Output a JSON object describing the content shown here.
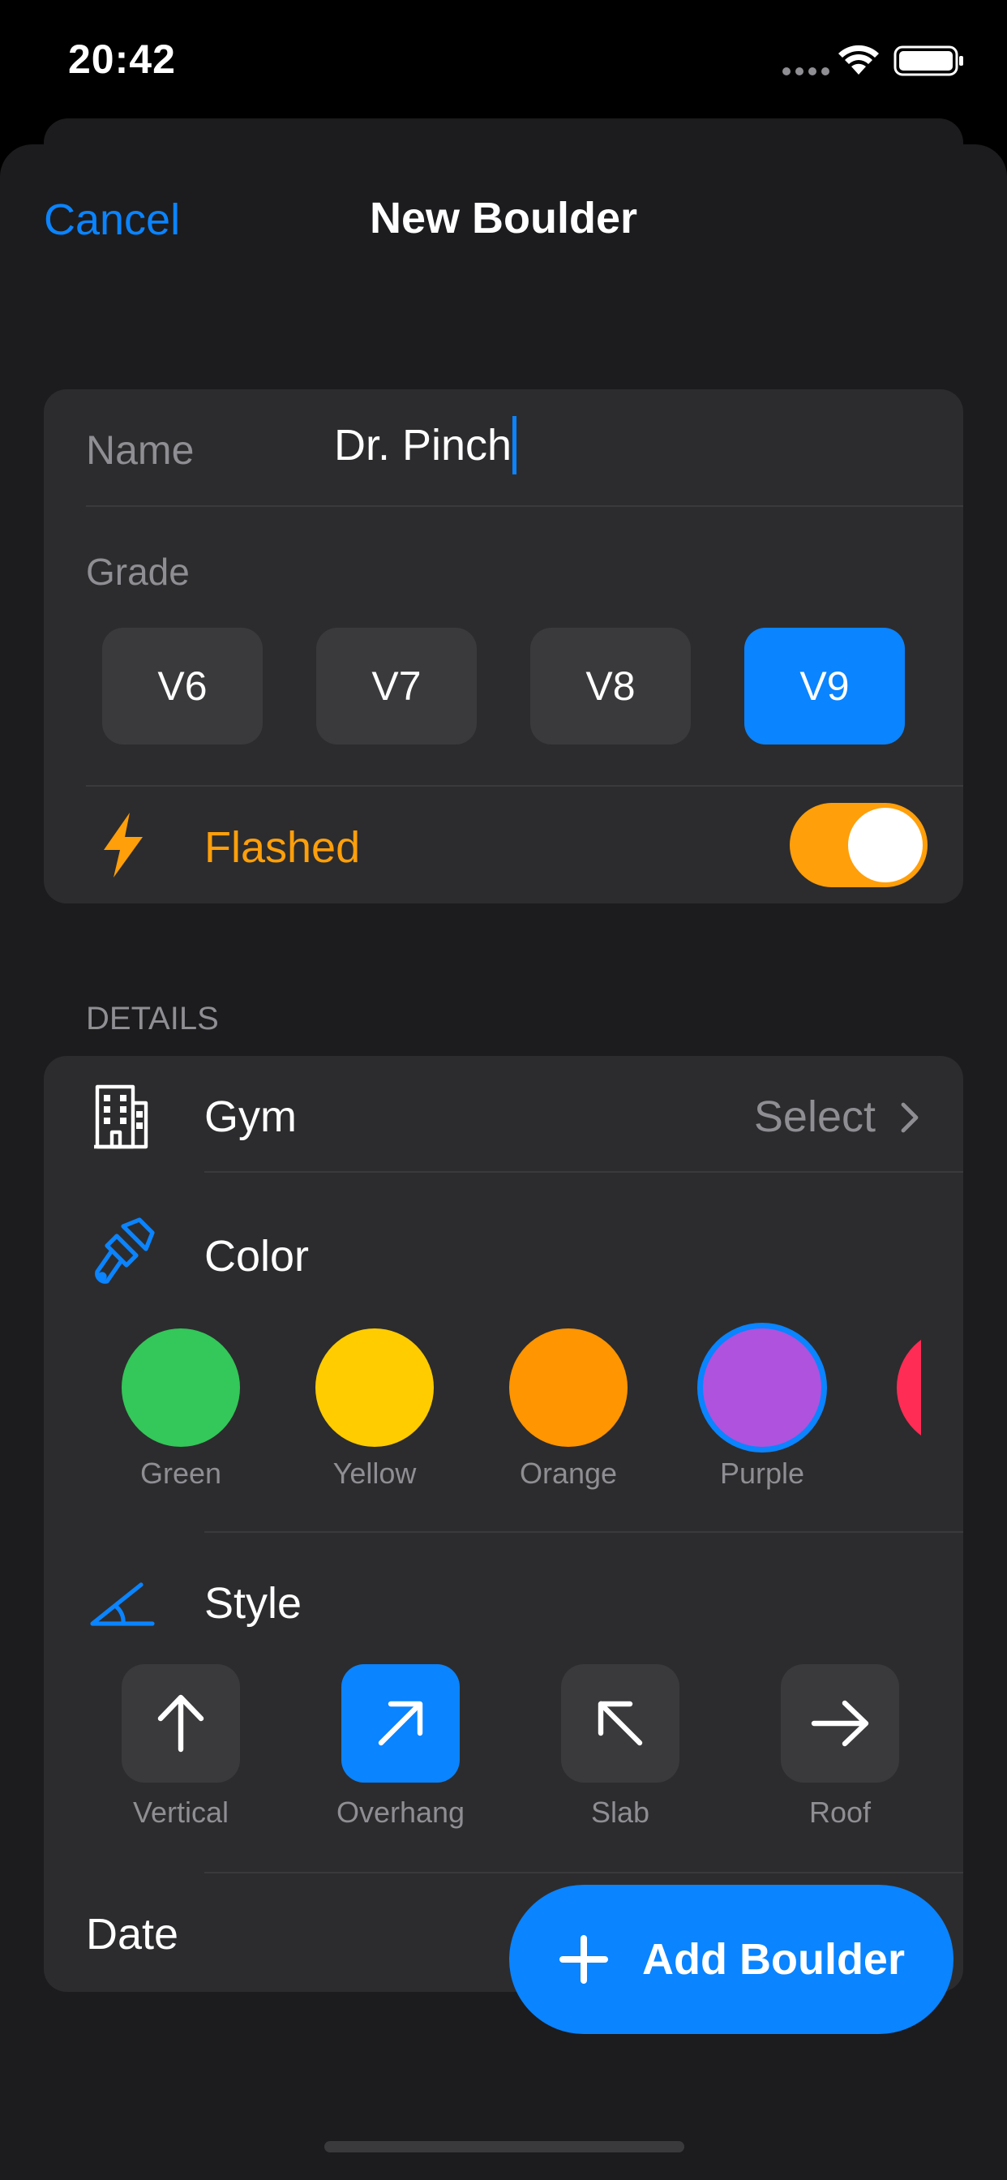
{
  "status": {
    "time": "20:42"
  },
  "nav": {
    "cancel_label": "Cancel",
    "title": "New Boulder"
  },
  "form": {
    "name_label": "Name",
    "name_value": "Dr. Pinch",
    "grade_label": "Grade",
    "grades": [
      "V6",
      "V7",
      "V8",
      "V9"
    ],
    "selected_grade": "V9",
    "flashed_label": "Flashed",
    "flashed_on": true
  },
  "details": {
    "section_title": "DETAILS",
    "gym_label": "Gym",
    "gym_value": "Select",
    "color_label": "Color",
    "colors": [
      {
        "label": "Green",
        "hex": "#34c759"
      },
      {
        "label": "Yellow",
        "hex": "#ffcc00"
      },
      {
        "label": "Orange",
        "hex": "#ff9500"
      },
      {
        "label": "Purple",
        "hex": "#af52de"
      },
      {
        "label": "",
        "hex": "#ff2d55"
      }
    ],
    "selected_color": "Purple",
    "style_label": "Style",
    "styles": [
      {
        "label": "Vertical",
        "icon": "arrow-up-icon"
      },
      {
        "label": "Overhang",
        "icon": "arrow-up-right-icon"
      },
      {
        "label": "Slab",
        "icon": "arrow-up-left-icon"
      },
      {
        "label": "Roof",
        "icon": "arrow-right-icon"
      }
    ],
    "selected_style": "Overhang",
    "date_label": "Date"
  },
  "actions": {
    "add_label": "Add Boulder"
  },
  "colors": {
    "accent": "#0a84ff",
    "flash": "#ff9f0a",
    "card": "#2c2c2e",
    "background": "#1c1c1e"
  }
}
